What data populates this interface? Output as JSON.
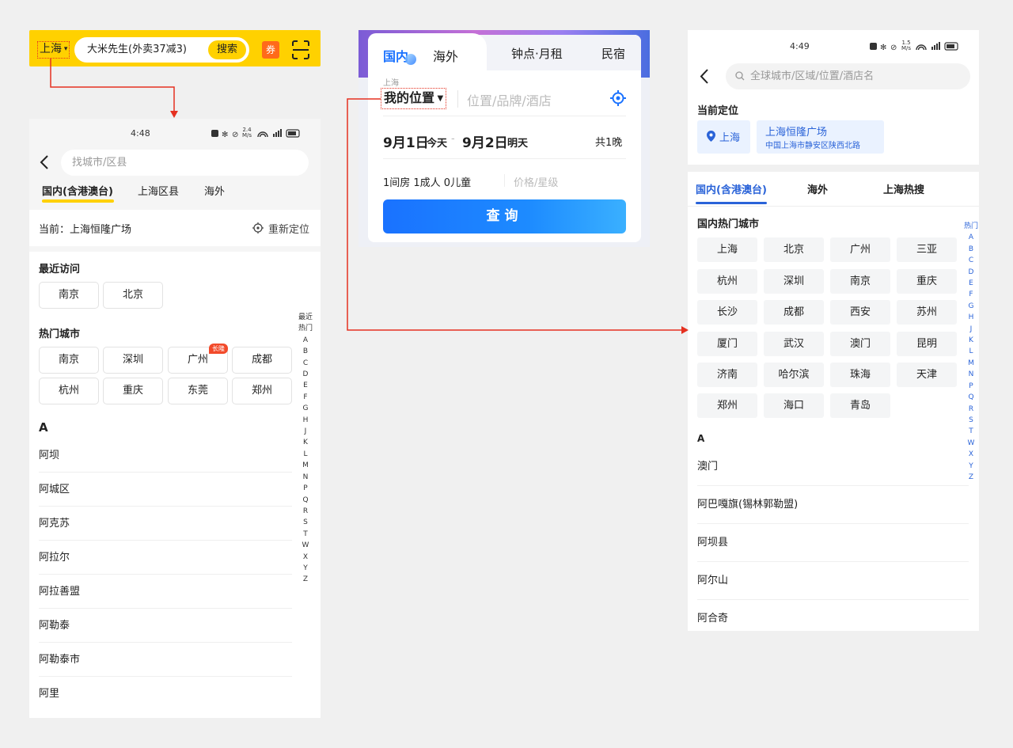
{
  "meituan_bar": {
    "city": "上海",
    "search_text": "大米先生(外卖37减3)",
    "search_button": "搜索",
    "coupon_label": "券"
  },
  "left_screen": {
    "status": {
      "time": "4:48",
      "speed": "2.4",
      "speed_unit": "M/s"
    },
    "search_placeholder": "找城市/区县",
    "tabs": [
      "国内(含港澳台)",
      "上海区县",
      "海外"
    ],
    "current_location": "当前：上海恒隆广场",
    "relocate": "重新定位",
    "recent_title": "最近访问",
    "recent": [
      "南京",
      "北京"
    ],
    "hot_title": "热门城市",
    "hot_row1": [
      "南京",
      "深圳",
      "广州",
      "成都"
    ],
    "hot_row2": [
      "杭州",
      "重庆",
      "东莞",
      "郑州"
    ],
    "hot_badge": "长隆",
    "index_head": [
      "最近",
      "热门"
    ],
    "index": [
      "A",
      "B",
      "C",
      "D",
      "E",
      "F",
      "G",
      "H",
      "J",
      "K",
      "L",
      "M",
      "N",
      "P",
      "Q",
      "R",
      "S",
      "T",
      "W",
      "X",
      "Y",
      "Z"
    ],
    "section_letter": "A",
    "cities": [
      "阿坝",
      "阿城区",
      "阿克苏",
      "阿拉尔",
      "阿拉善盟",
      "阿勒泰",
      "阿勒泰市",
      "阿里"
    ]
  },
  "hotel_card": {
    "tabs": [
      "国内",
      "海外",
      "钟点·月租",
      "民宿"
    ],
    "city_small": "上海",
    "my_location": "我的位置",
    "keyword_placeholder": "位置/品牌/酒店",
    "checkin": "9月1日",
    "checkin_tag": "今天",
    "dash": "-",
    "checkout": "9月2日",
    "checkout_tag": "明天",
    "nights": "共1晚",
    "guests": "1间房 1成人 0儿童",
    "price_placeholder": "价格/星级",
    "query_button": "查询"
  },
  "right_screen": {
    "status": {
      "time": "4:49",
      "speed": "1.5",
      "speed_unit": "M/s"
    },
    "search_placeholder": "全球城市/区域/位置/酒店名",
    "current_title": "当前定位",
    "current_city": "上海",
    "current_place": "上海恒隆广场",
    "current_address": "中国上海市静安区陕西北路",
    "tabs": [
      "国内(含港澳台)",
      "海外",
      "上海热搜"
    ],
    "hot_title": "国内热门城市",
    "hot_rows": [
      [
        "上海",
        "北京",
        "广州",
        "三亚"
      ],
      [
        "杭州",
        "深圳",
        "南京",
        "重庆"
      ],
      [
        "长沙",
        "成都",
        "西安",
        "苏州"
      ],
      [
        "厦门",
        "武汉",
        "澳门",
        "昆明"
      ],
      [
        "济南",
        "哈尔滨",
        "珠海",
        "天津"
      ],
      [
        "郑州",
        "海口",
        "青岛"
      ]
    ],
    "index_head": "热门",
    "index": [
      "A",
      "B",
      "C",
      "D",
      "E",
      "F",
      "G",
      "H",
      "J",
      "K",
      "L",
      "M",
      "N",
      "P",
      "Q",
      "R",
      "S",
      "T",
      "W",
      "X",
      "Y",
      "Z"
    ],
    "section_letter": "A",
    "cities": [
      "澳门",
      "阿巴嘎旗(锡林郭勒盟)",
      "阿坝县",
      "阿尔山",
      "阿合奇"
    ]
  },
  "colors": {
    "meituan_yellow": "#ffd100",
    "arrow_red": "#e53020",
    "ctrip_blue": "#1a72ff"
  }
}
